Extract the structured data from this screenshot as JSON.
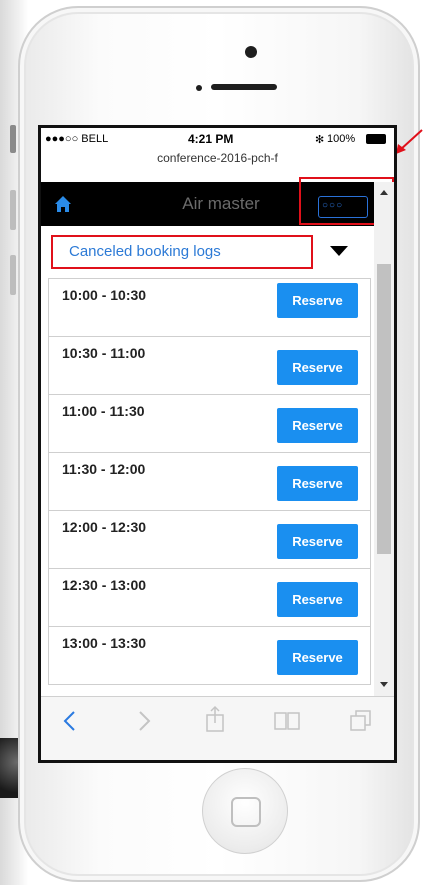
{
  "status_bar": {
    "carrier": "●●●○○ BELL",
    "time": "4:21 PM",
    "bluetooth": "✻",
    "battery": "100%"
  },
  "browser": {
    "url": "conference-2016-pch-f"
  },
  "app": {
    "title": "Air master",
    "menu_label": "○○○",
    "dropdown_label": "Canceled booking logs"
  },
  "slots": [
    {
      "time": "10:00 - 10:30",
      "action": "Reserve"
    },
    {
      "time": "10:30 - 11:00",
      "action": "Reserve"
    },
    {
      "time": "11:00 - 11:30",
      "action": "Reserve"
    },
    {
      "time": "11:30 - 12:00",
      "action": "Reserve"
    },
    {
      "time": "12:00 - 12:30",
      "action": "Reserve"
    },
    {
      "time": "12:30 - 13:00",
      "action": "Reserve"
    },
    {
      "time": "13:00 - 13:30",
      "action": "Reserve"
    }
  ],
  "icons": {
    "home": "home-icon",
    "back": "chevron-left-icon",
    "forward": "chevron-right-icon",
    "share": "share-icon",
    "bookmarks": "book-icon",
    "tabs": "tabs-icon"
  },
  "colors": {
    "accent": "#1a8ff0",
    "highlight": "#e0101a",
    "header_bg": "#000000",
    "link": "#2c7ad6"
  }
}
